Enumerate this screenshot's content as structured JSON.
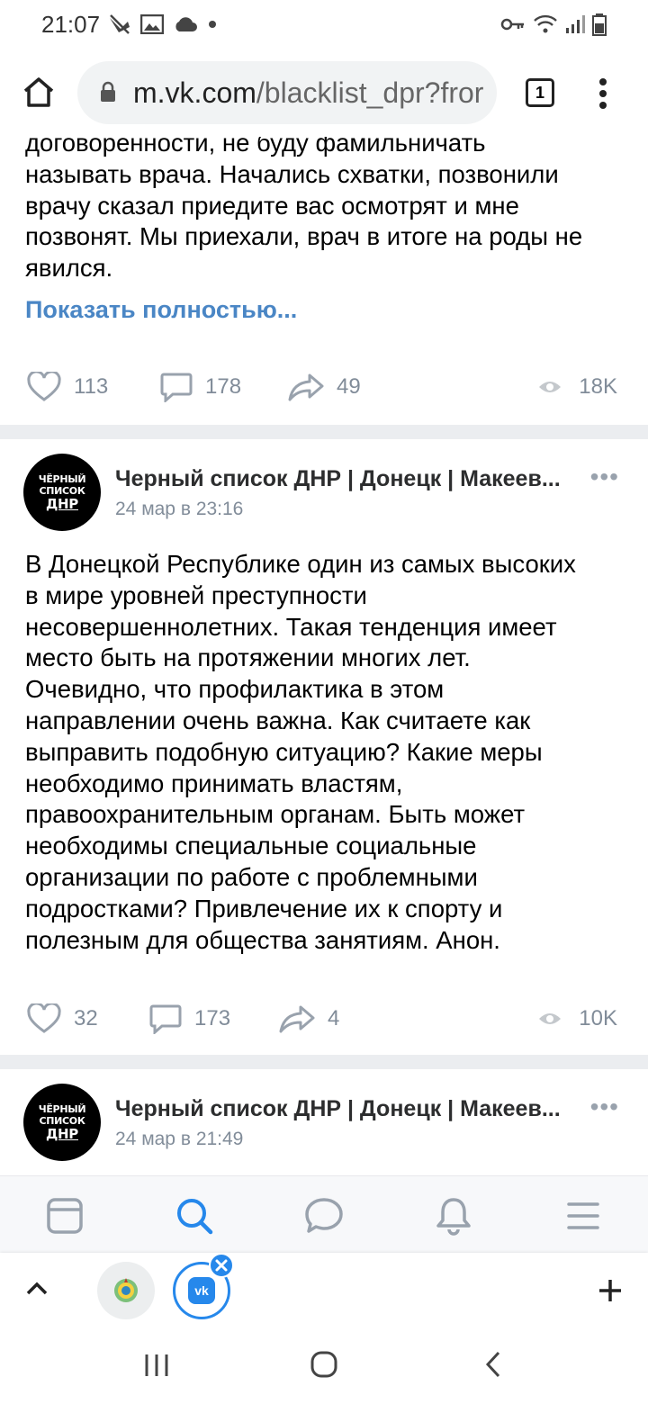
{
  "status_bar": {
    "time": "21:07"
  },
  "browser": {
    "url_host": "m.vk.com",
    "url_path": "/blacklist_dpr?fror",
    "tab_count": "1"
  },
  "post1": {
    "text_lines": [
      "договорённости, не буду фамильничать",
      "называть врача. Начались схватки, позвонили",
      "врачу сказал приедите вас осмотрят и мне",
      "позвонят. Мы приехали, врач в итоге на роды не",
      "явился."
    ],
    "show_more": "Показать полностью...",
    "likes": "113",
    "comments": "178",
    "shares": "49",
    "views": "18K"
  },
  "post2": {
    "author": "Черный список ДНР | Донецк | Макеев...",
    "date": "24 мар в 23:16",
    "avatar_lines": [
      "ЧЁРНЫЙ",
      "СПИСОК",
      "ДНР"
    ],
    "text_lines": [
      "В Донецкой Республике один из самых высоких",
      "в мире уровней преступности",
      "несовершеннолетних. Такая тенденция имеет",
      "место быть на протяжении многих лет.",
      "Очевидно, что профилактика в этом",
      "направлении очень важна. Как считаете как",
      "выправить подобную ситуацию? Какие меры",
      "необходимо принимать властям,",
      "правоохранительным органам. Быть может",
      "необходимы специальные социальные",
      "организации по работе с проблемными",
      "подростками? Привлечение их к спорту и",
      "полезным для общества занятиям. Анон."
    ],
    "likes": "32",
    "comments": "173",
    "shares": "4",
    "views": "10K"
  },
  "post3": {
    "author": "Черный список ДНР | Донецк | Макеев...",
    "date": "24 мар в 21:49",
    "avatar_lines": [
      "ЧЁРНЫЙ",
      "СПИСОК",
      "ДНР"
    ]
  },
  "colors": {
    "link": "#4a86c5",
    "icon_gray": "#818c99",
    "nav_active": "#2688eb",
    "separator": "#ebedf0"
  },
  "icons": [
    "home-icon",
    "lock-icon",
    "tabs-icon",
    "menu-icon",
    "heart-icon",
    "comment-icon",
    "share-icon",
    "eye-icon",
    "newsfeed-icon",
    "search-icon",
    "messages-icon",
    "bell-icon",
    "menu-lines-icon",
    "chevron-up-icon",
    "vk-icon",
    "close-icon",
    "plus-icon",
    "recents-icon",
    "home-circle-icon",
    "back-icon"
  ]
}
